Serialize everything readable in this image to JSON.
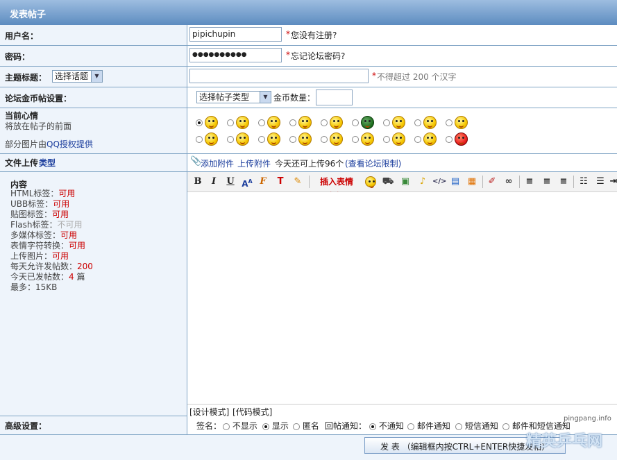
{
  "header": {
    "title": "发表帖子"
  },
  "username": {
    "label": "用户名：",
    "value": "pipichupin",
    "hint_star": "*",
    "hint": "您没有注册?"
  },
  "password": {
    "label": "密码：",
    "value": "●●●●●●●●●●",
    "hint_star": "*",
    "hint": "忘记论坛密码?"
  },
  "subject": {
    "label": "主题标题：",
    "topic_select": "选择话题",
    "hint_star": "*",
    "hint": "不得超过 200 个汉字",
    "value": ""
  },
  "coins": {
    "label": "论坛金币帖设置：",
    "type_select": "选择帖子类型",
    "amount_label": "金币数量：",
    "amount_value": ""
  },
  "mood": {
    "label": "当前心情",
    "desc1": "将放在帖子的前面",
    "desc2_prefix": "部分图片由",
    "desc2_link": "QQ授权提供"
  },
  "upload": {
    "label": "文件上传",
    "label_type": " 类型",
    "add_attachment": "添加附件",
    "upload_attachment": "上传附件",
    "remaining_text": "今天还可上传96个",
    "view_limit": "(查看论坛限制)"
  },
  "content": {
    "title": "内容",
    "rules": [
      {
        "name": "HTML标签：",
        "value": "可用",
        "status": "ok"
      },
      {
        "name": "UBB标签：",
        "value": "可用",
        "status": "ok"
      },
      {
        "name": "贴图标签：",
        "value": "可用",
        "status": "ok"
      },
      {
        "name": "Flash标签：",
        "value": "不可用",
        "status": "off"
      },
      {
        "name": "多媒体标签：",
        "value": "可用",
        "status": "ok"
      },
      {
        "name": "表情字符转换：",
        "value": "可用",
        "status": "ok"
      },
      {
        "name": "上传图片：",
        "value": "可用",
        "status": "ok"
      }
    ],
    "daily_allowed_label": "每天允许发帖数：",
    "daily_allowed_value": "200",
    "today_posted_label": "今天已发帖数：",
    "today_posted_value": "4",
    "today_posted_unit": " 篇",
    "max_label": "最多：",
    "max_value": "15KB"
  },
  "editor": {
    "insert_emotion": "插入表情 >>",
    "design_mode": "[设计模式]",
    "code_mode": "[代码模式]",
    "text": ""
  },
  "advanced": {
    "label": "高级设置：",
    "signature_label": "签名：",
    "sig_hide": "不显示",
    "sig_show": "显示",
    "sig_anon": "匿名",
    "reply_label": "回帖通知：",
    "notify_none": "不通知",
    "notify_mail": "邮件通知",
    "notify_sms": "短信通知",
    "notify_both": "邮件和短信通知"
  },
  "submit": {
    "label": "发 表 （编辑框内按CTRL+ENTER快捷发帖）"
  },
  "watermark": {
    "url": "pingpang.info",
    "brand": "精英乒乓网"
  },
  "colors": {
    "header_bg": "#6d9ac8",
    "label_bg": "#eef4fb",
    "border": "#7ea3c4",
    "star": "#cc0000",
    "link": "#1a3c9c"
  }
}
